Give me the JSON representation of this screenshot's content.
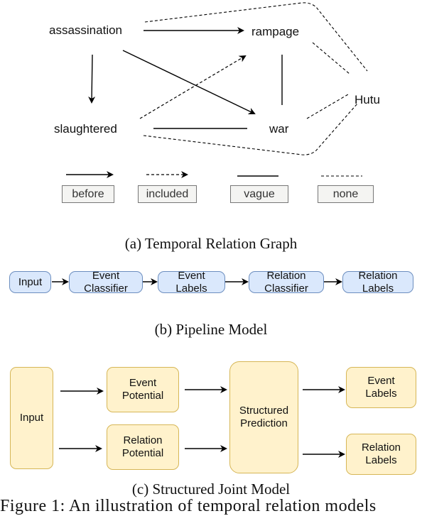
{
  "graph": {
    "nodes": {
      "assassination": "assassination",
      "rampage": "rampage",
      "slaughtered": "slaughtered",
      "war": "war",
      "hutu": "Hutu"
    },
    "edges": [
      {
        "from": "assassination",
        "to": "rampage",
        "relation": "before"
      },
      {
        "from": "assassination",
        "to": "slaughtered",
        "relation": "before"
      },
      {
        "from": "assassination",
        "to": "war",
        "relation": "before"
      },
      {
        "from": "slaughtered",
        "to": "rampage",
        "relation": "included"
      },
      {
        "from": "rampage",
        "to": "war",
        "relation": "vague"
      },
      {
        "from": "slaughtered",
        "to": "war",
        "relation": "vague"
      },
      {
        "from": "assassination",
        "to": "Hutu",
        "relation": "none"
      },
      {
        "from": "rampage",
        "to": "Hutu",
        "relation": "none"
      },
      {
        "from": "war",
        "to": "Hutu",
        "relation": "none"
      },
      {
        "from": "slaughtered",
        "to": "Hutu",
        "relation": "none"
      }
    ],
    "legend": [
      "before",
      "included",
      "vague",
      "none"
    ]
  },
  "captions": {
    "a": "(a) Temporal Relation Graph",
    "b": "(b) Pipeline Model",
    "c": "(c) Structured Joint Model"
  },
  "pipeline": {
    "boxes": [
      {
        "line1": "Input",
        "line2": ""
      },
      {
        "line1": "Event",
        "line2": "Classifier"
      },
      {
        "line1": "Event",
        "line2": "Labels"
      },
      {
        "line1": "Relation",
        "line2": "Classifier"
      },
      {
        "line1": "Relation",
        "line2": "Labels"
      }
    ]
  },
  "joint": {
    "input": "Input",
    "event_potential": [
      "Event",
      "Potential"
    ],
    "relation_potential": [
      "Relation",
      "Potential"
    ],
    "structured_prediction": [
      "Structured",
      "Prediction"
    ],
    "event_labels": [
      "Event",
      "Labels"
    ],
    "relation_labels": [
      "Relation",
      "Labels"
    ]
  },
  "figure_caption_partial": "Figure 1: An illustration of temporal relation models"
}
